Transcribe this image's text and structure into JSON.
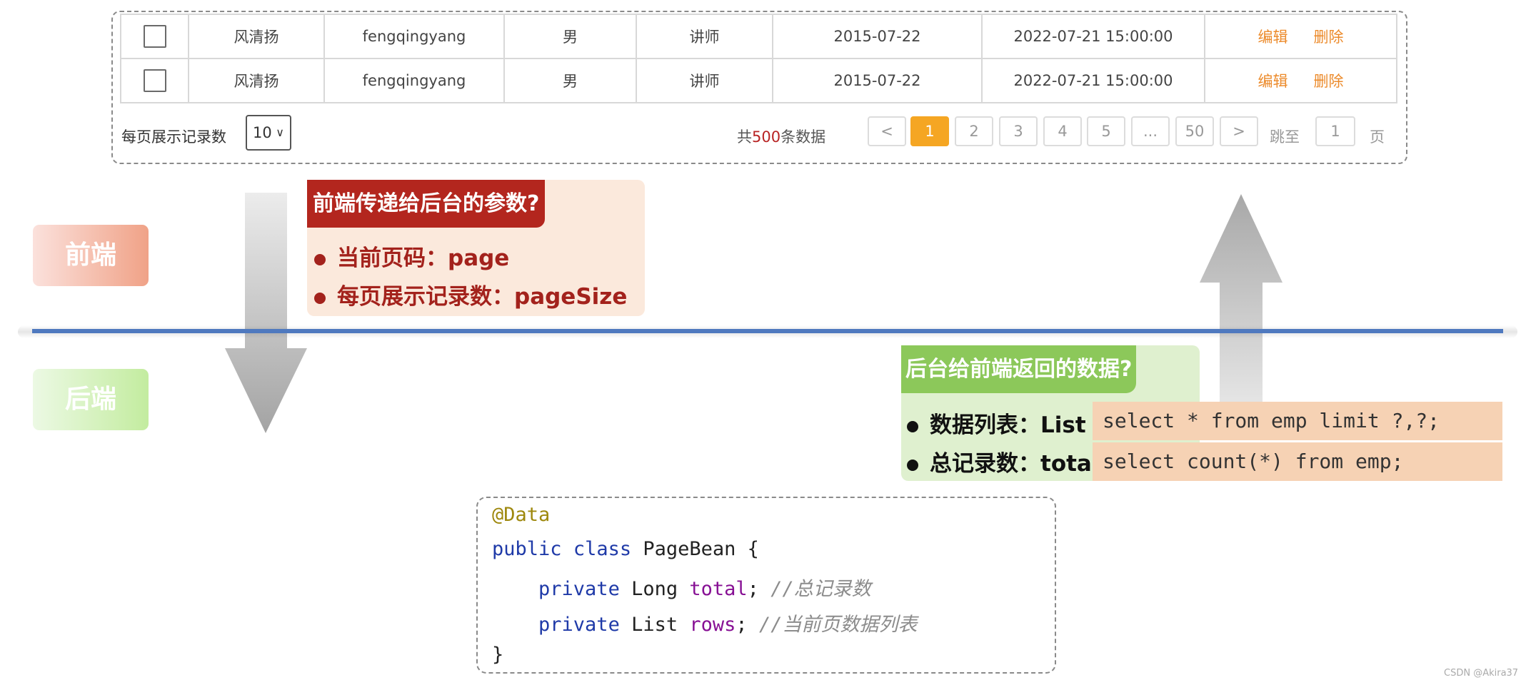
{
  "table": {
    "rows": [
      {
        "name": "风清扬",
        "username": "fengqingyang",
        "gender": "男",
        "job": "讲师",
        "entry_date": "2015-07-22",
        "update_time": "2022-07-21 15:00:00",
        "edit": "编辑",
        "delete": "删除"
      },
      {
        "name": "风清扬",
        "username": "fengqingyang",
        "gender": "男",
        "job": "讲师",
        "entry_date": "2015-07-22",
        "update_time": "2022-07-21 15:00:00",
        "edit": "编辑",
        "delete": "删除"
      }
    ]
  },
  "pager": {
    "page_size_label": "每页展示记录数",
    "page_size_value": "10",
    "total_prefix": "共",
    "total_count": "500",
    "total_suffix": "条数据",
    "prev": "<",
    "pages": [
      "1",
      "2",
      "3",
      "4",
      "5",
      "...",
      "50"
    ],
    "active_page": "1",
    "next": ">",
    "jump_label": "跳至",
    "jump_value": "1",
    "jump_unit": "页"
  },
  "tags": {
    "frontend": "前端",
    "backend": "后端"
  },
  "request": {
    "title": "前端传递给后台的参数?",
    "items": [
      "当前页码：page",
      "每页展示记录数：pageSize"
    ]
  },
  "response": {
    "title": "后台给前端返回的数据?",
    "items": [
      "数据列表：List",
      "总记录数：total"
    ]
  },
  "sql": [
    "select * from emp limit ?,?;",
    "select count(*) from emp;"
  ],
  "code": {
    "annotation": "@Data",
    "l2_public": "public",
    "l2_class": "class",
    "l2_rest": "PageBean {",
    "l3_private": "private",
    "l3_type": "Long",
    "l3_field": "total",
    "l3_comment": "//总记录数",
    "l4_private": "private",
    "l4_type": "List",
    "l4_field": "rows",
    "l4_comment": "//当前页数据列表",
    "close": "}"
  },
  "colors": {
    "divider": "#4f79bf",
    "request_title_bg": "#b3261e",
    "response_title_bg": "#8cc85a",
    "active_page": "#f5a623",
    "op_link": "#ec8a2a"
  },
  "watermark": "CSDN @Akira37"
}
